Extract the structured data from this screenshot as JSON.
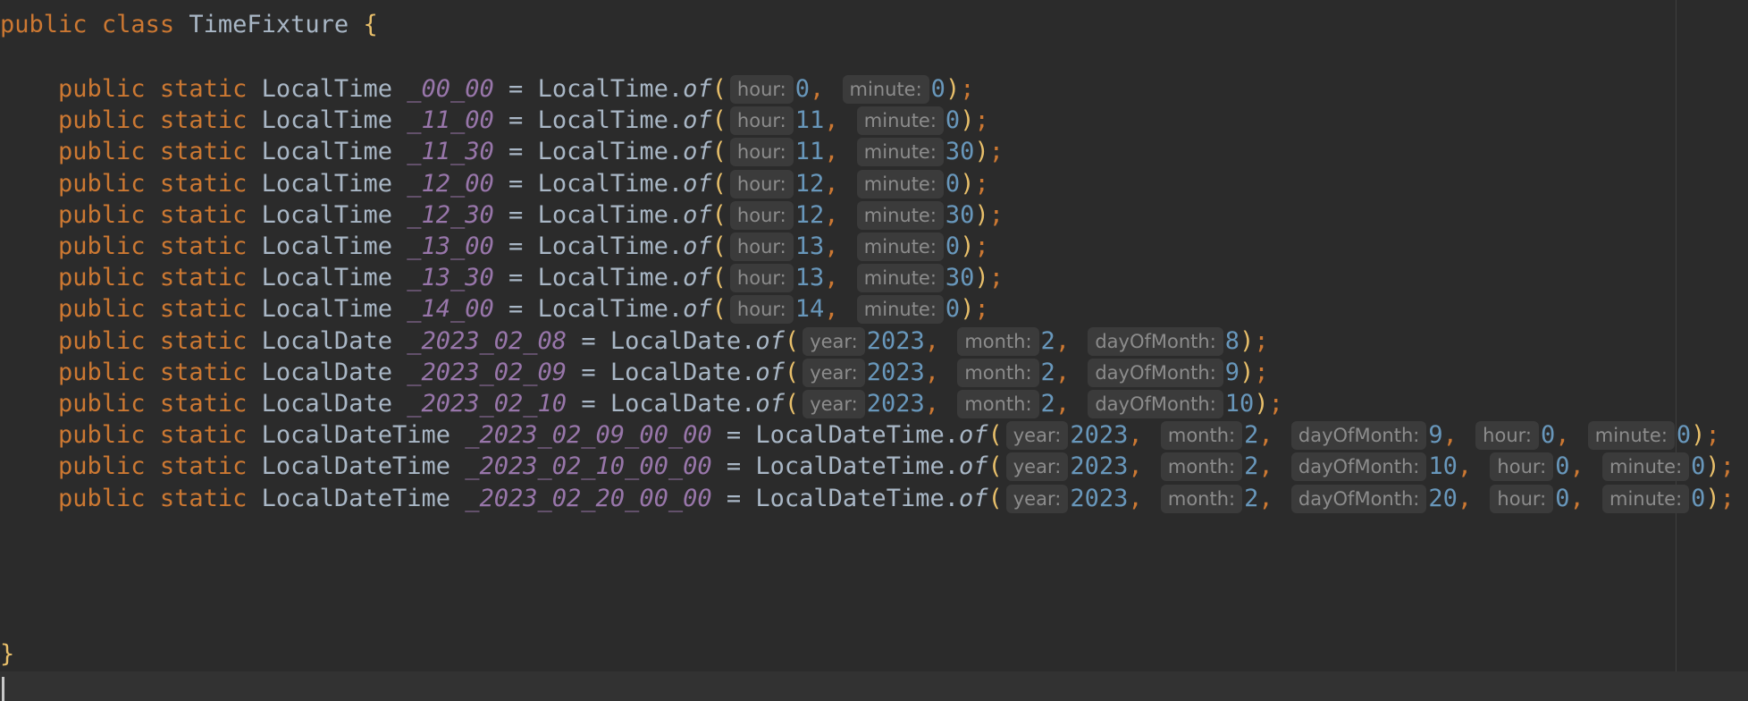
{
  "editor": {
    "class_decl": {
      "kw_public": "public",
      "kw_class": "class",
      "name": "TimeFixture",
      "open_brace": "{"
    },
    "close_brace": "}",
    "lines": [
      {
        "type": "LocalTime",
        "field": "_00_00",
        "method": "LocalTime.",
        "call": "of",
        "args": [
          {
            "hint": "hour:",
            "value": "0"
          },
          {
            "hint": "minute:",
            "value": "0"
          }
        ]
      },
      {
        "type": "LocalTime",
        "field": "_11_00",
        "method": "LocalTime.",
        "call": "of",
        "args": [
          {
            "hint": "hour:",
            "value": "11"
          },
          {
            "hint": "minute:",
            "value": "0"
          }
        ]
      },
      {
        "type": "LocalTime",
        "field": "_11_30",
        "method": "LocalTime.",
        "call": "of",
        "args": [
          {
            "hint": "hour:",
            "value": "11"
          },
          {
            "hint": "minute:",
            "value": "30"
          }
        ]
      },
      {
        "type": "LocalTime",
        "field": "_12_00",
        "method": "LocalTime.",
        "call": "of",
        "args": [
          {
            "hint": "hour:",
            "value": "12"
          },
          {
            "hint": "minute:",
            "value": "0"
          }
        ]
      },
      {
        "type": "LocalTime",
        "field": "_12_30",
        "method": "LocalTime.",
        "call": "of",
        "args": [
          {
            "hint": "hour:",
            "value": "12"
          },
          {
            "hint": "minute:",
            "value": "30"
          }
        ]
      },
      {
        "type": "LocalTime",
        "field": "_13_00",
        "method": "LocalTime.",
        "call": "of",
        "args": [
          {
            "hint": "hour:",
            "value": "13"
          },
          {
            "hint": "minute:",
            "value": "0"
          }
        ]
      },
      {
        "type": "LocalTime",
        "field": "_13_30",
        "method": "LocalTime.",
        "call": "of",
        "args": [
          {
            "hint": "hour:",
            "value": "13"
          },
          {
            "hint": "minute:",
            "value": "30"
          }
        ]
      },
      {
        "type": "LocalTime",
        "field": "_14_00",
        "method": "LocalTime.",
        "call": "of",
        "args": [
          {
            "hint": "hour:",
            "value": "14"
          },
          {
            "hint": "minute:",
            "value": "0"
          }
        ]
      },
      {
        "type": "LocalDate",
        "field": "_2023_02_08",
        "method": "LocalDate.",
        "call": "of",
        "args": [
          {
            "hint": "year:",
            "value": "2023"
          },
          {
            "hint": "month:",
            "value": "2"
          },
          {
            "hint": "dayOfMonth:",
            "value": "8"
          }
        ]
      },
      {
        "type": "LocalDate",
        "field": "_2023_02_09",
        "method": "LocalDate.",
        "call": "of",
        "args": [
          {
            "hint": "year:",
            "value": "2023"
          },
          {
            "hint": "month:",
            "value": "2"
          },
          {
            "hint": "dayOfMonth:",
            "value": "9"
          }
        ]
      },
      {
        "type": "LocalDate",
        "field": "_2023_02_10",
        "method": "LocalDate.",
        "call": "of",
        "args": [
          {
            "hint": "year:",
            "value": "2023"
          },
          {
            "hint": "month:",
            "value": "2"
          },
          {
            "hint": "dayOfMonth:",
            "value": "10"
          }
        ]
      },
      {
        "type": "LocalDateTime",
        "field": "_2023_02_09_00_00",
        "method": "LocalDateTime.",
        "call": "of",
        "args": [
          {
            "hint": "year:",
            "value": "2023"
          },
          {
            "hint": "month:",
            "value": "2"
          },
          {
            "hint": "dayOfMonth:",
            "value": "9"
          },
          {
            "hint": "hour:",
            "value": "0"
          },
          {
            "hint": "minute:",
            "value": "0"
          }
        ]
      },
      {
        "type": "LocalDateTime",
        "field": "_2023_02_10_00_00",
        "method": "LocalDateTime.",
        "call": "of",
        "args": [
          {
            "hint": "year:",
            "value": "2023"
          },
          {
            "hint": "month:",
            "value": "2"
          },
          {
            "hint": "dayOfMonth:",
            "value": "10"
          },
          {
            "hint": "hour:",
            "value": "0"
          },
          {
            "hint": "minute:",
            "value": "0"
          }
        ]
      },
      {
        "type": "LocalDateTime",
        "field": "_2023_02_20_00_00",
        "method": "LocalDateTime.",
        "call": "of",
        "args": [
          {
            "hint": "year:",
            "value": "2023"
          },
          {
            "hint": "month:",
            "value": "2"
          },
          {
            "hint": "dayOfMonth:",
            "value": "20"
          },
          {
            "hint": "hour:",
            "value": "0"
          },
          {
            "hint": "minute:",
            "value": "0"
          }
        ]
      }
    ],
    "tokens": {
      "public": "public",
      "static": "static",
      "eq": "=",
      "open_paren": "(",
      "close_paren": ")",
      "comma": ",",
      "semicolon": ";"
    }
  },
  "colors": {
    "background": "#2b2b2b",
    "keyword": "#cc7832",
    "field": "#9876aa",
    "number": "#6897bb",
    "text": "#a9b7c6",
    "brace": "#e8bf6a"
  }
}
